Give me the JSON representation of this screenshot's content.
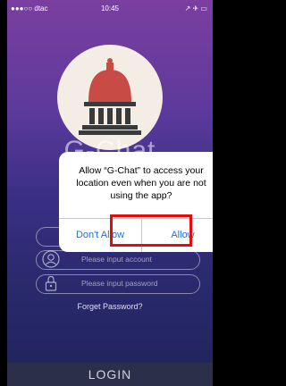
{
  "status_bar": {
    "carrier": "●●●○○ dtac",
    "time": "10:45",
    "right": "↗ ✈ ▭"
  },
  "app": {
    "title": "G-Chat"
  },
  "form": {
    "account_placeholder": "Please input account",
    "password_placeholder": "Please input password",
    "forget_label": "Forget Password?",
    "login_label": "LOGIN"
  },
  "dialog": {
    "message": "Allow “G-Chat” to access your location even when you are not using the app?",
    "deny_label": "Don't Allow",
    "allow_label": "Allow"
  },
  "colors": {
    "accent": "#1d71d6",
    "highlight": "#e10d0d",
    "logo_roof": "#c94b45",
    "logo_building": "#3a3a3a"
  },
  "icons": {
    "logo": "building-icon",
    "account": "user-icon",
    "password": "lock-icon"
  }
}
